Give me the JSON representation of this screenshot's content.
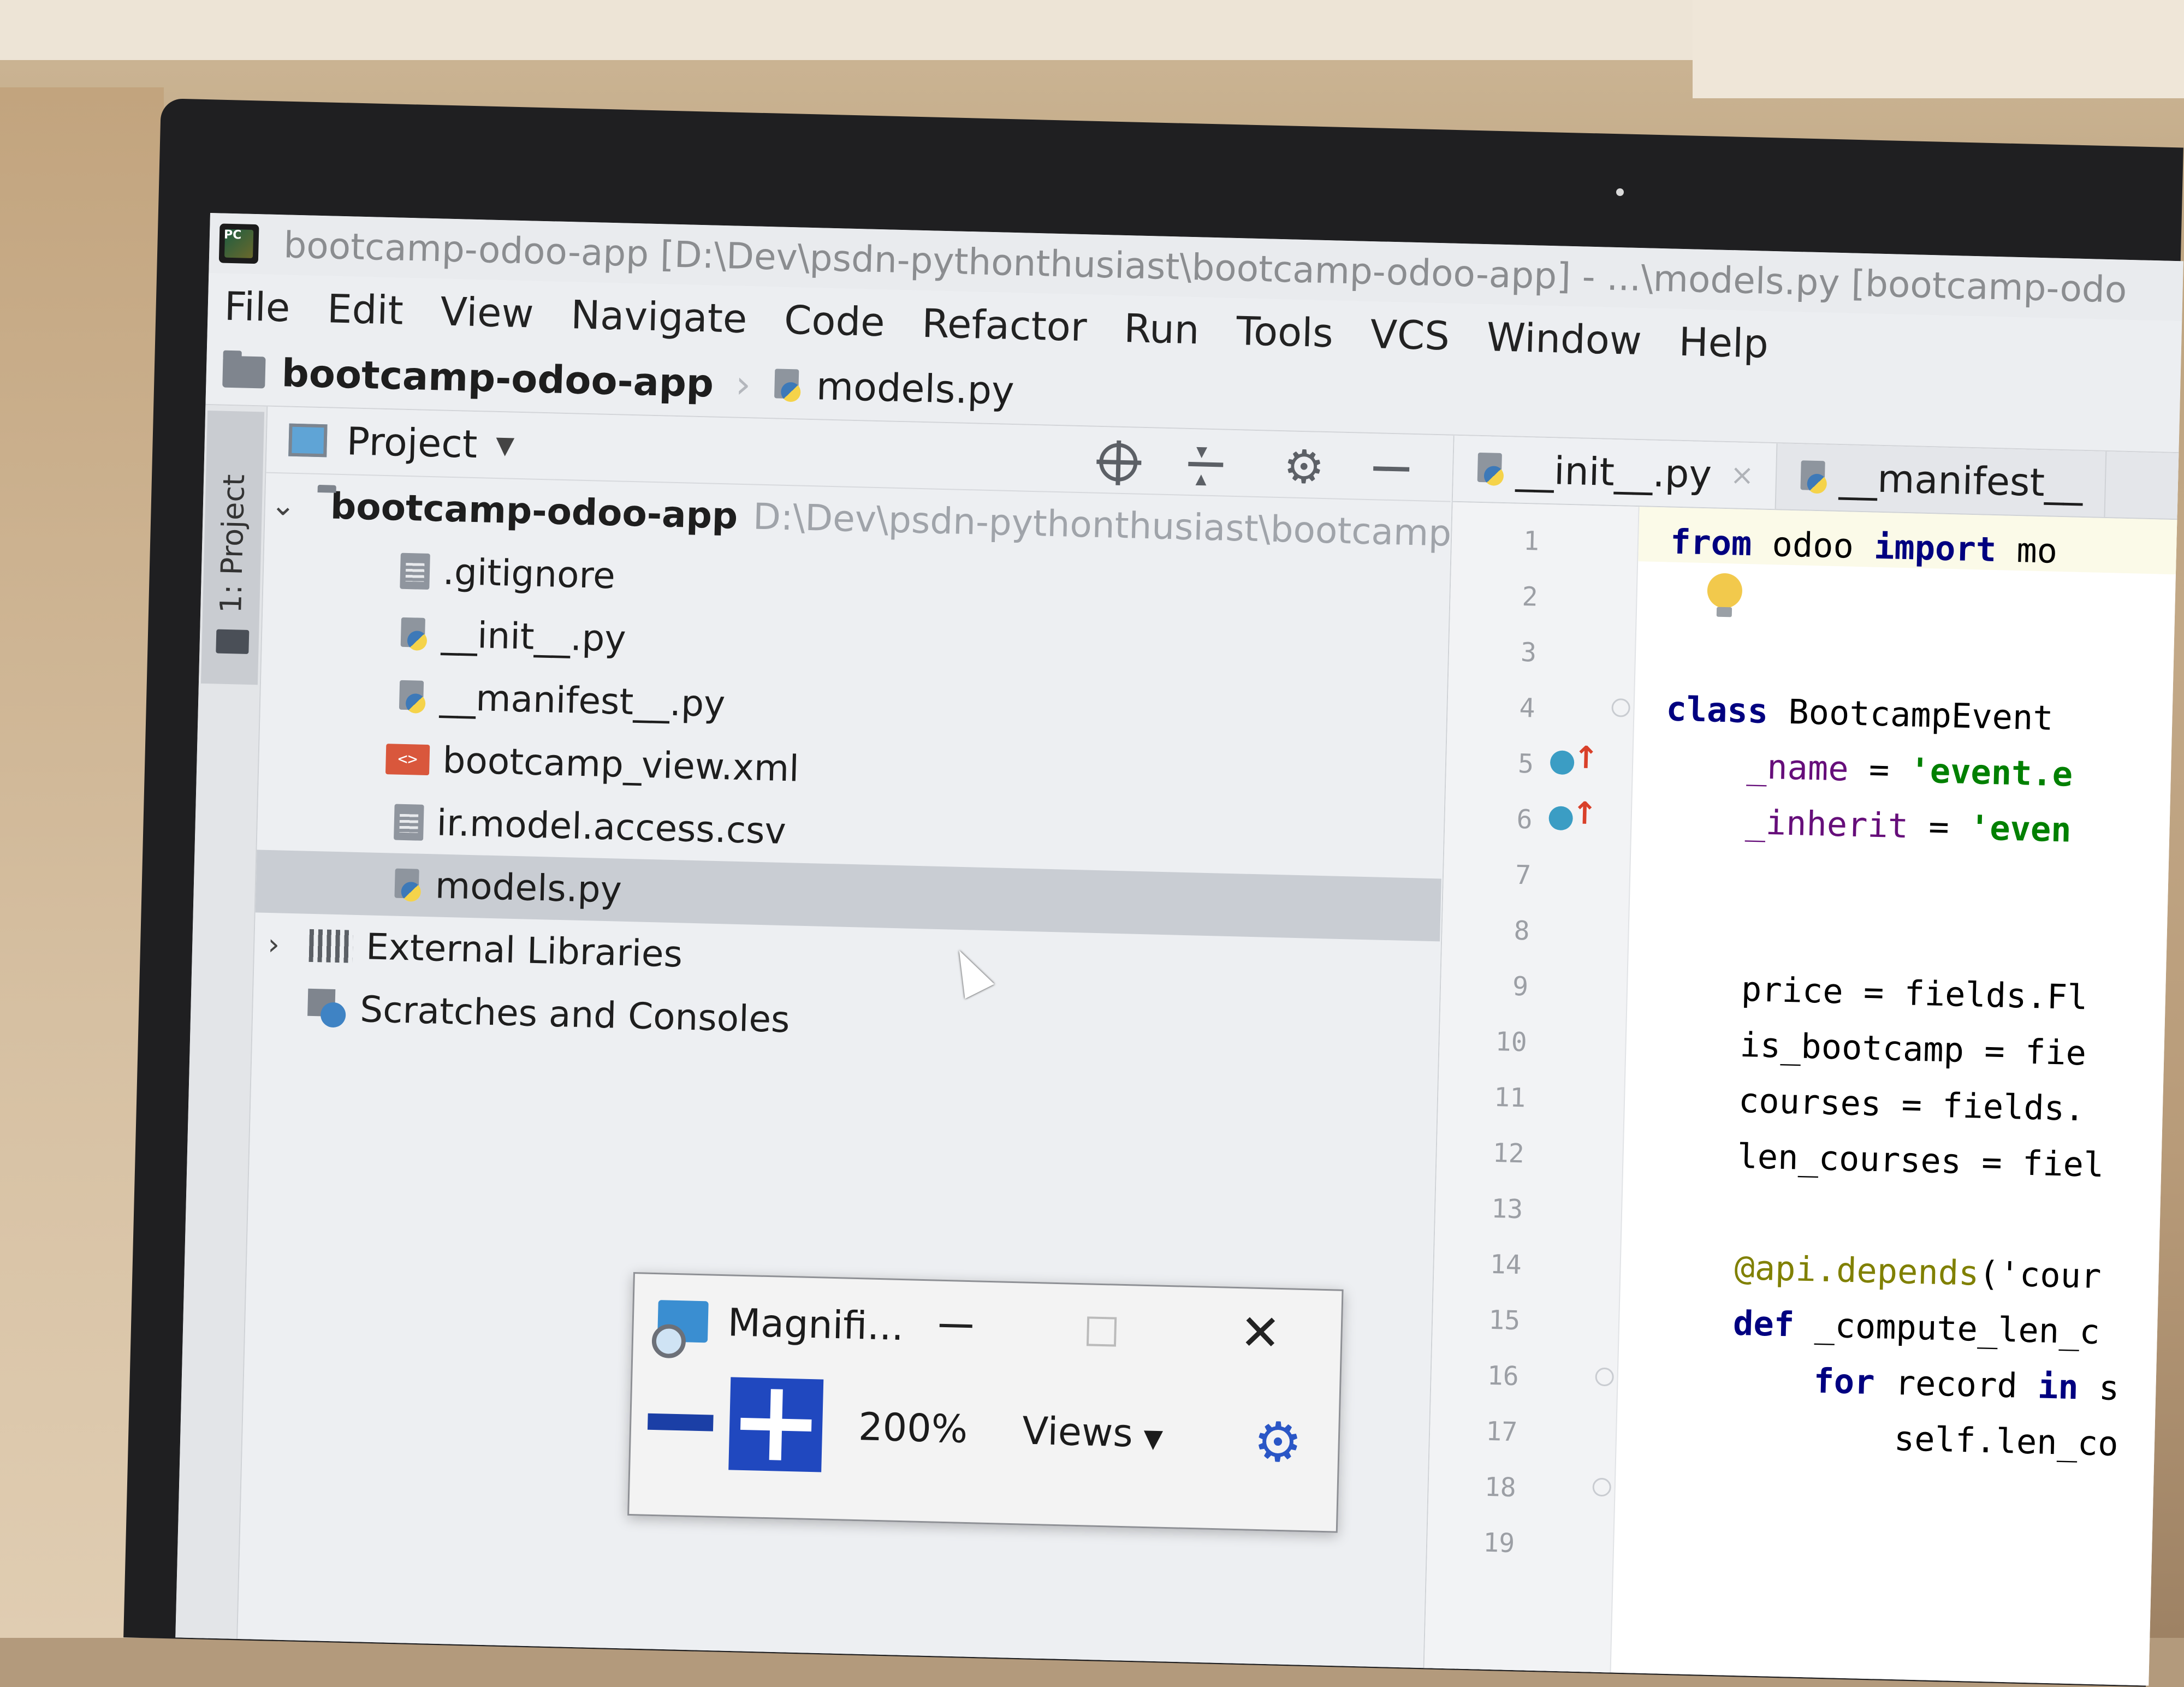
{
  "window": {
    "app_icon_text": "PC",
    "title": "bootcamp-odoo-app [D:\\Dev\\psdn-pythonthusiast\\bootcamp-odoo-app] - ...\\models.py [bootcamp-odo"
  },
  "menu": [
    "File",
    "Edit",
    "View",
    "Navigate",
    "Code",
    "Refactor",
    "Run",
    "Tools",
    "VCS",
    "Window",
    "Help"
  ],
  "navbar": {
    "root": "bootcamp-odoo-app",
    "file": "models.py"
  },
  "tool_window": {
    "project_label": "1: Project"
  },
  "project_panel": {
    "title": "Project",
    "root": {
      "name": "bootcamp-odoo-app",
      "path": "D:\\Dev\\psdn-pythonthusiast\\bootcamp"
    },
    "files": [
      ".gitignore",
      "__init__.py",
      "__manifest__.py",
      "bootcamp_view.xml",
      "ir.model.access.csv",
      "models.py"
    ],
    "selected": "models.py",
    "external_libraries": "External Libraries",
    "scratches": "Scratches and Consoles",
    "icons": [
      "crosshair-icon",
      "collapse-all-icon",
      "gear-icon",
      "minimize-icon"
    ]
  },
  "editor": {
    "tabs": [
      {
        "label": "__init__.py",
        "closable": true
      },
      {
        "label": "__manifest__",
        "closable": false
      }
    ],
    "line_numbers": [
      "1",
      "2",
      "3",
      "4",
      "5",
      "6",
      "7",
      "8",
      "9",
      "10",
      "11",
      "12",
      "13",
      "14",
      "15",
      "16",
      "17",
      "18",
      "19"
    ],
    "code": {
      "l1": {
        "kw1": "from",
        "mod": " odoo ",
        "kw2": "import",
        "rest": " mo"
      },
      "l4": {
        "kw": "class",
        "name": " BootcampEvent"
      },
      "l5": {
        "lhs": "_name",
        "op": " = ",
        "str": "'event.e"
      },
      "l6": {
        "lhs": "_inherit",
        "op": " = ",
        "str": "'even"
      },
      "l9": "price = fields.Fl",
      "l10": "is_bootcamp = fie",
      "l11": "courses = fields.",
      "l12": "len_courses = fiel",
      "l14": {
        "dec": "@api.depends",
        "rest": "('cour"
      },
      "l15": {
        "kw": "def",
        "rest": " _compute_len_c"
      },
      "l16": {
        "kw1": "for",
        "mid": " record ",
        "kw2": "in",
        "rest": " s"
      },
      "l17": "self.len_co"
    }
  },
  "magnifier": {
    "title": "Magnifi...",
    "zoom": "200%",
    "views": "Views"
  },
  "colors": {
    "keyword": "#000080",
    "string": "#008000",
    "decorator": "#808000",
    "selection": "#c9cdd3",
    "magnifier_accent": "#2048bf"
  }
}
